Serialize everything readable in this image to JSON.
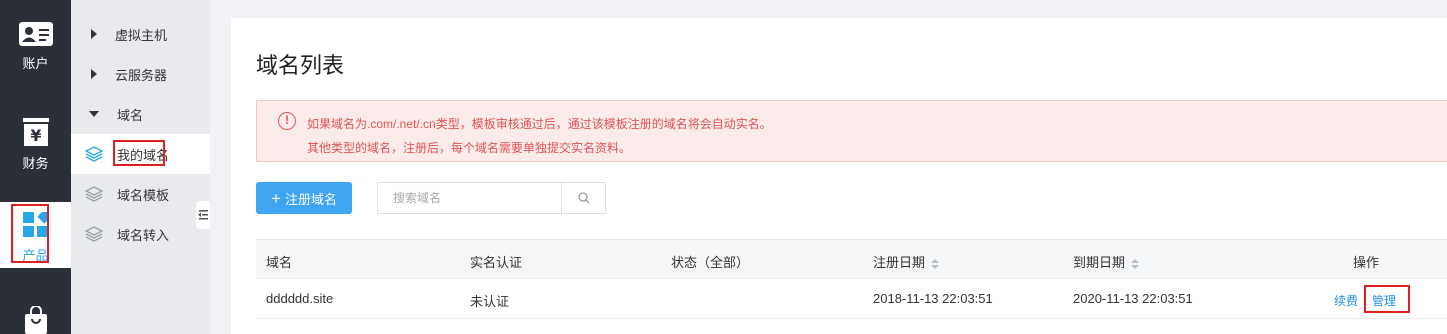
{
  "rail": {
    "items": [
      {
        "label": "账户",
        "icon": "id-card-icon"
      },
      {
        "label": "财务",
        "icon": "yen-icon"
      },
      {
        "label": "产品",
        "icon": "product-grid-icon"
      },
      {
        "label": "",
        "icon": "shopping-bag-icon"
      }
    ],
    "active_color": "#27a7e7"
  },
  "sidebar": {
    "groups": [
      {
        "label": "虚拟主机",
        "expanded": false
      },
      {
        "label": "云服务器",
        "expanded": false
      },
      {
        "label": "域名",
        "expanded": true
      }
    ],
    "sub_items": [
      {
        "label": "我的域名",
        "icon": "layers-icon",
        "active": true
      },
      {
        "label": "域名模板",
        "icon": "layers-icon",
        "active": false
      },
      {
        "label": "域名转入",
        "icon": "layers-icon",
        "active": false
      }
    ]
  },
  "main": {
    "title": "域名列表",
    "notice": {
      "line1": "如果域名为.com/.net/.cn类型，模板审核通过后，通过该模板注册的域名将会自动实名。",
      "line2": "其他类型的域名，注册后，每个域名需要单独提交实名资料。"
    },
    "register_button": "注册域名",
    "search": {
      "placeholder": "搜索域名",
      "value": ""
    },
    "table": {
      "headers": {
        "domain": "域名",
        "verify": "实名认证",
        "status": "状态（全部）",
        "reg_date": "注册日期",
        "exp_date": "到期日期",
        "actions": "操作"
      },
      "rows": [
        {
          "domain": "dddddd.site",
          "verify": "未认证",
          "status": "",
          "reg_date": "2018-11-13 22:03:51",
          "exp_date": "2020-11-13 22:03:51",
          "renew": "续费",
          "manage": "管理"
        }
      ]
    }
  },
  "colors": {
    "primary": "#3fa4f2",
    "link": "#1e8fe1",
    "warning": "#e05555",
    "highlight_box": "#e02020"
  }
}
